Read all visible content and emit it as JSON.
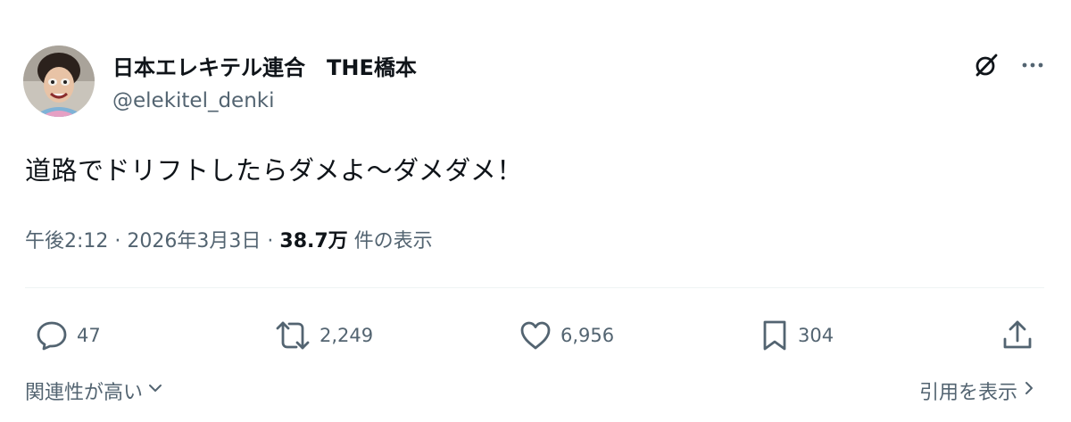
{
  "author": {
    "display_name": "日本エレキテル連合　THE橋本",
    "handle": "@elekitel_denki"
  },
  "post": {
    "text": "道路でドリフトしたらダメよ～ダメダメ！",
    "time": "午後2:12",
    "separator": "·",
    "date": "2026年3月3日",
    "views_count": "38.7万",
    "views_label": "件の表示"
  },
  "actions": {
    "replies": "47",
    "reposts": "2,249",
    "likes": "6,956",
    "bookmarks": "304"
  },
  "footer": {
    "related_label": "関連性が高い",
    "show_quotes_label": "引用を表示"
  },
  "icons": {
    "top": [
      "grok-icon",
      "more-icon"
    ],
    "actions": [
      "reply-icon",
      "repost-icon",
      "like-icon",
      "bookmark-icon",
      "share-icon"
    ]
  },
  "colors": {
    "text_primary": "#0f1419",
    "text_secondary": "#536471",
    "divider": "#eff3f4"
  }
}
